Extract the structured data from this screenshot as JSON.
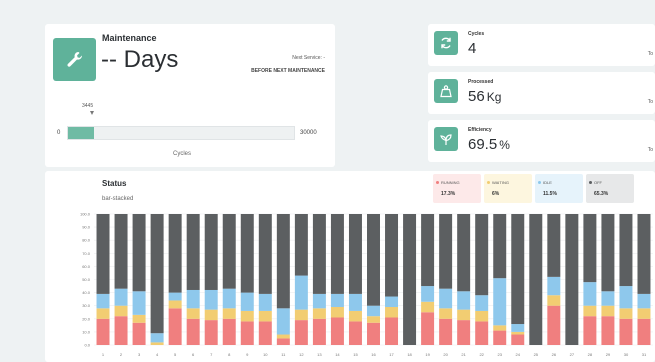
{
  "maintenance": {
    "title": "Maintenance",
    "value": "-- Days",
    "next_service": "Next Service: -",
    "before_next": "BEFORE NEXT MAINTENANCE",
    "cycles_current": 3445,
    "cycles_min": "0",
    "cycles_max": "30000",
    "cycles_label": "Cycles",
    "progress_fraction": 0.115
  },
  "stats": [
    {
      "title": "Cycles",
      "value": "4",
      "unit": "",
      "edge": "To",
      "icon": "refresh-icon"
    },
    {
      "title": "Processed",
      "value": "56",
      "unit": "Kg",
      "edge": "To",
      "icon": "weight-icon"
    },
    {
      "title": "Efficiency",
      "value": "69.5",
      "unit": "%",
      "edge": "To",
      "icon": "leaf-icon"
    }
  ],
  "status": {
    "title": "Status",
    "subtitle": "bar-stacked",
    "legend": [
      {
        "name": "RUNNING",
        "value": "17.3%",
        "color": "#f07f7f",
        "bg": "#fde9e9"
      },
      {
        "name": "WAITING",
        "value": "6%",
        "color": "#f2cd72",
        "bg": "#fdf6df"
      },
      {
        "name": "IDLE",
        "value": "11.5%",
        "color": "#8ec8ec",
        "bg": "#e6f3fb"
      },
      {
        "name": "OFF",
        "value": "65.3%",
        "color": "#5c5f61",
        "bg": "#e7e8e9"
      }
    ]
  },
  "colors": {
    "accent": "#5fb29a",
    "running": "#f07f7f",
    "waiting": "#f2cd72",
    "idle": "#8ec8ec",
    "off": "#5c5f61"
  },
  "chart_data": {
    "type": "bar",
    "stacked": true,
    "ylim": [
      0,
      100
    ],
    "yticks": [
      "0.0",
      "10.0",
      "20.0",
      "30.0",
      "40.0",
      "50.0",
      "60.0",
      "70.0",
      "80.0",
      "90.0",
      "100.0"
    ],
    "ylabel": "",
    "categories": [
      "1",
      "2",
      "3",
      "4",
      "5",
      "6",
      "7",
      "8",
      "9",
      "10",
      "11",
      "12",
      "13",
      "14",
      "15",
      "16",
      "17",
      "18",
      "19",
      "20",
      "21",
      "22",
      "23",
      "24",
      "25",
      "26",
      "27",
      "28",
      "29",
      "30",
      "31"
    ],
    "series": [
      {
        "name": "RUNNING",
        "values": [
          20,
          22,
          17,
          0,
          28,
          20,
          19,
          20,
          18,
          18,
          5,
          19,
          20,
          21,
          18,
          17,
          21,
          0,
          25,
          20,
          19,
          18,
          11,
          8,
          0,
          30,
          0,
          22,
          22,
          20,
          20
        ]
      },
      {
        "name": "WAITING",
        "values": [
          8,
          8,
          6,
          2,
          6,
          8,
          8,
          8,
          8,
          8,
          3,
          8,
          8,
          8,
          8,
          5,
          8,
          0,
          8,
          8,
          8,
          8,
          4,
          2,
          0,
          8,
          0,
          8,
          8,
          8,
          8
        ]
      },
      {
        "name": "IDLE",
        "values": [
          11,
          13,
          18,
          7,
          6,
          14,
          15,
          15,
          14,
          13,
          20,
          26,
          11,
          10,
          13,
          8,
          8,
          0,
          12,
          15,
          14,
          12,
          36,
          6,
          0,
          14,
          0,
          18,
          11,
          17,
          11
        ]
      },
      {
        "name": "OFF",
        "values": [
          61,
          57,
          59,
          91,
          60,
          58,
          58,
          57,
          60,
          61,
          72,
          47,
          61,
          61,
          61,
          70,
          63,
          100,
          55,
          57,
          59,
          62,
          49,
          84,
          100,
          48,
          100,
          52,
          59,
          55,
          61
        ]
      }
    ]
  }
}
